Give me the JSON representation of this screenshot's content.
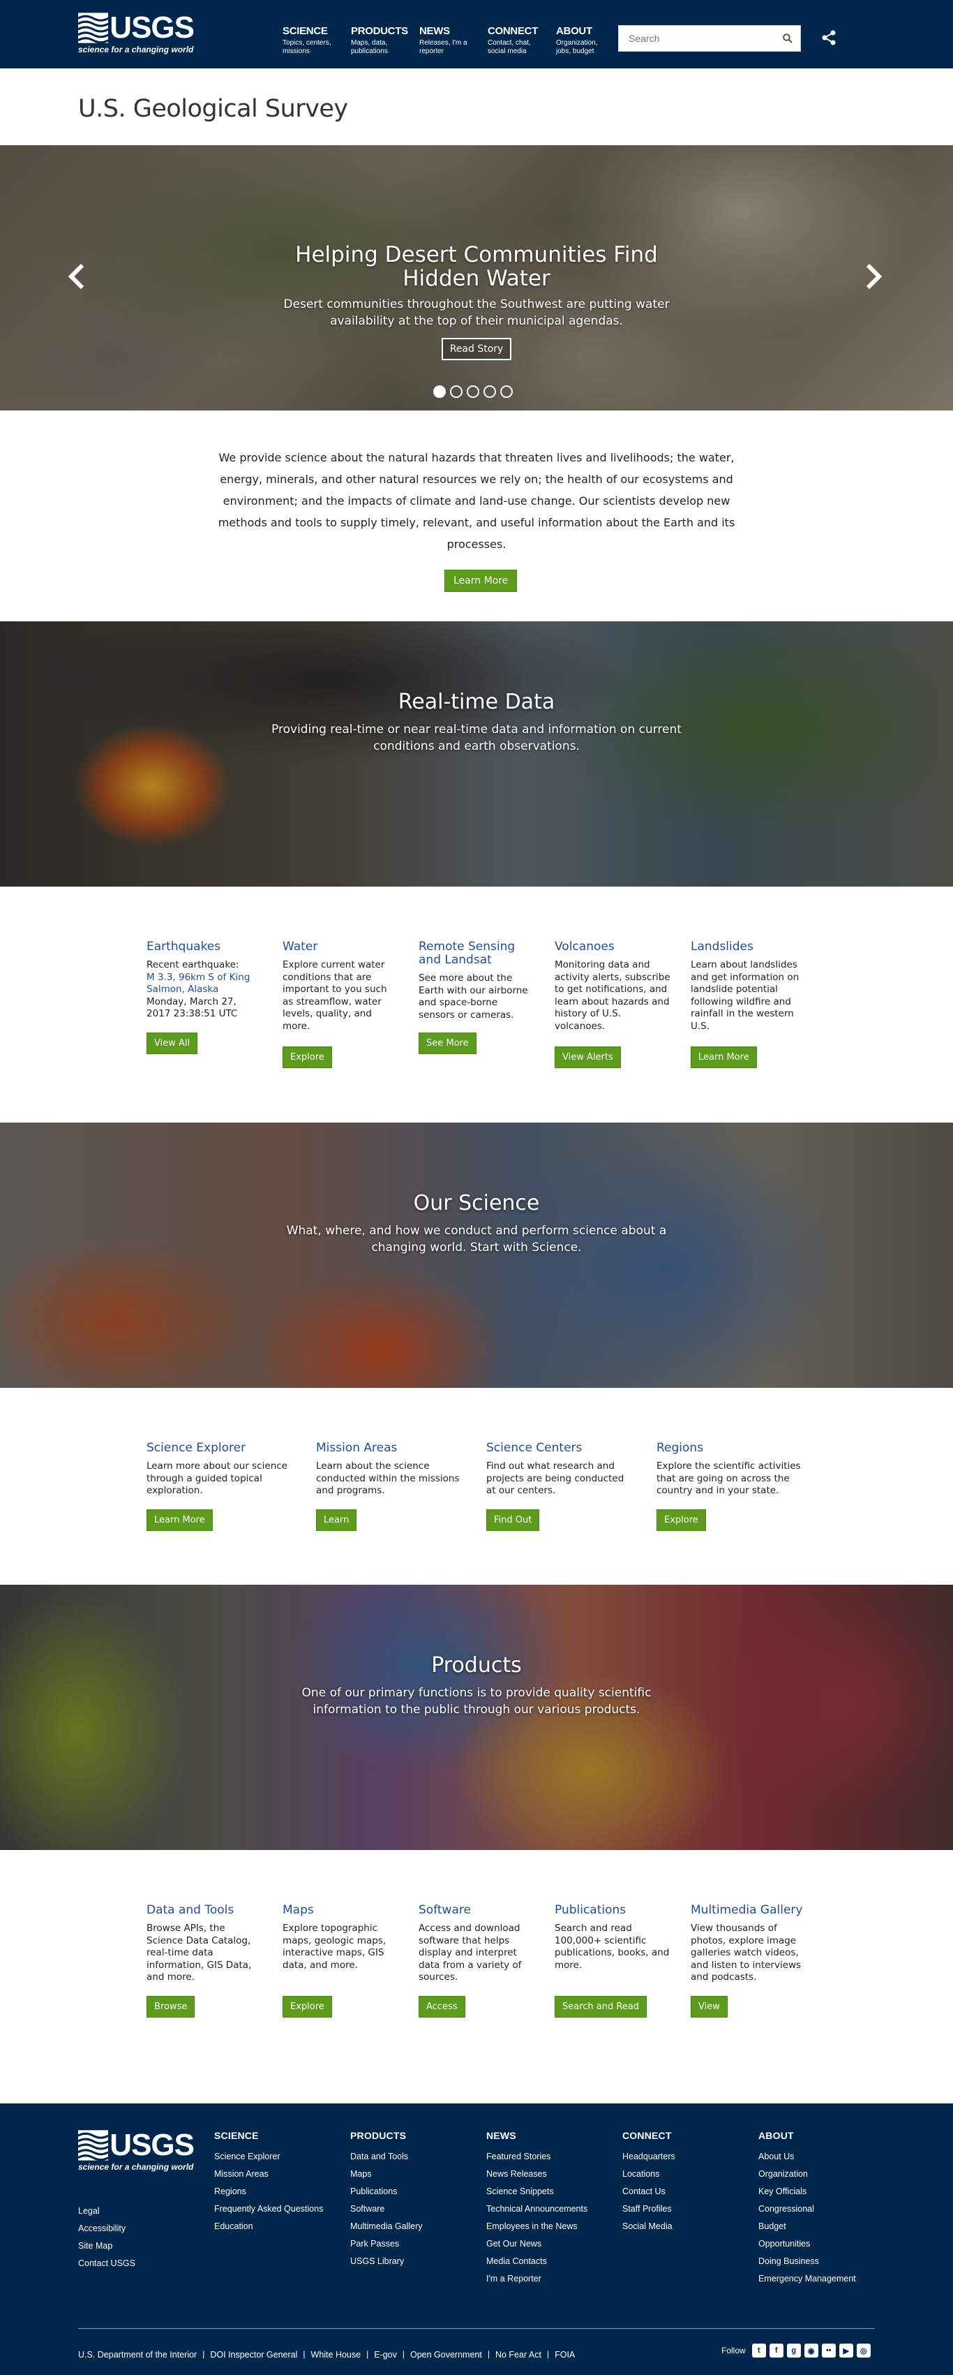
{
  "brand": {
    "name": "USGS",
    "tagline": "science for a changing world"
  },
  "nav": [
    {
      "title": "SCIENCE",
      "sub": "Topics, centers, missions"
    },
    {
      "title": "PRODUCTS",
      "sub": "Maps, data, publications"
    },
    {
      "title": "NEWS",
      "sub": "Releases, I'm a reporter"
    },
    {
      "title": "CONNECT",
      "sub": "Contact, chat, social media"
    },
    {
      "title": "ABOUT",
      "sub": "Organization, jobs, budget"
    }
  ],
  "search": {
    "placeholder": "Search"
  },
  "page_title": "U.S. Geological Survey",
  "hero": {
    "title": "Helping Desert Communities Find Hidden Water",
    "desc": "Desert communities throughout the Southwest are putting water availability at the top of their municipal agendas.",
    "button": "Read Story"
  },
  "intro": {
    "text": "We provide science about the natural hazards that threaten lives and livelihoods; the water, energy, minerals, and other natural resources we rely on; the health of our ecosystems and environment; and the impacts of climate and land-use change. Our scientists develop new methods and tools to supply timely, relevant, and useful information about the Earth and its processes.",
    "button": "Learn More"
  },
  "realtime": {
    "title": "Real-time Data",
    "desc": "Providing real-time or near real-time data and information on current conditions and earth observations.",
    "cards": [
      {
        "title": "Earthquakes",
        "desc_pre": "Recent earthquake:",
        "link": "M 3.3, 96km S of King Salmon, Alaska",
        "desc_post": " Monday, March 27, 2017 23:38:51 UTC",
        "button": "View All"
      },
      {
        "title": "Water",
        "desc": "Explore current water conditions that are important to you such as streamflow, water levels, quality, and more.",
        "button": "Explore"
      },
      {
        "title": "Remote Sensing and Landsat",
        "desc": "See more about the Earth with our airborne and space-borne sensors or cameras.",
        "button": "See More"
      },
      {
        "title": "Volcanoes",
        "desc": "Monitoring data and activity alerts, subscribe to get notifications, and learn about hazards and history of U.S. volcanoes.",
        "button": "View Alerts"
      },
      {
        "title": "Landslides",
        "desc": "Learn about landslides and get information on landslide potential following wildfire and rainfall in the western U.S.",
        "button": "Learn More"
      }
    ]
  },
  "science": {
    "title": "Our Science",
    "desc": "What, where, and how we conduct and perform science about a changing world. Start with Science.",
    "cards": [
      {
        "title": "Science Explorer",
        "desc": "Learn more about our science through a guided topical exploration.",
        "button": "Learn More"
      },
      {
        "title": "Mission Areas",
        "desc": "Learn about the science conducted within the missions and programs.",
        "button": "Learn"
      },
      {
        "title": "Science Centers",
        "desc": "Find out what research and projects are being conducted at our centers.",
        "button": "Find Out"
      },
      {
        "title": "Regions",
        "desc": "Explore the scientific activities that are going on across the country and in your state.",
        "button": "Explore"
      }
    ]
  },
  "products": {
    "title": "Products",
    "desc": "One of our primary functions is to provide quality scientific information to the public through our various products.",
    "cards": [
      {
        "title": "Data and Tools",
        "desc": "Browse APIs, the Science Data Catalog, real-time data information, GIS Data, and more.",
        "button": "Browse"
      },
      {
        "title": "Maps",
        "desc": "Explore topographic maps, geologic maps, interactive maps, GIS data, and more.",
        "button": "Explore"
      },
      {
        "title": "Software",
        "desc": "Access and download software that helps display and interpret data from a variety of sources.",
        "button": "Access"
      },
      {
        "title": "Publications",
        "desc": "Search and read 100,000+ scientific publications, books, and more.",
        "button": "Search and Read"
      },
      {
        "title": "Multimedia Gallery",
        "desc": "View thousands of photos, explore image galleries watch videos, and listen to interviews and podcasts.",
        "button": "View"
      }
    ]
  },
  "footer": {
    "left_links": [
      "Legal",
      "Accessibility",
      "Site Map",
      "Contact USGS"
    ],
    "columns": [
      {
        "title": "SCIENCE",
        "links": [
          "Science Explorer",
          "Mission Areas",
          "Regions",
          "Frequently Asked Questions",
          "Education"
        ]
      },
      {
        "title": "PRODUCTS",
        "links": [
          "Data and Tools",
          "Maps",
          "Publications",
          "Software",
          "Multimedia Gallery",
          "Park Passes",
          "USGS Library"
        ]
      },
      {
        "title": "NEWS",
        "links": [
          "Featured Stories",
          "News Releases",
          "Science Snippets",
          "Technical Announcements",
          "Employees in the News",
          "Get Our News",
          "Media Contacts",
          "I'm a Reporter"
        ]
      },
      {
        "title": "CONNECT",
        "links": [
          "Headquarters",
          "Locations",
          "Contact Us",
          "Staff Profiles",
          "Social Media"
        ]
      },
      {
        "title": "ABOUT",
        "links": [
          "About Us",
          "Organization",
          "Key Officials",
          "Congressional",
          "Budget",
          "Opportunities",
          "Doing Business",
          "Emergency Management"
        ]
      }
    ],
    "bottom_links": [
      "U.S. Department of the Interior",
      "DOI Inspector General",
      "White House",
      "E-gov",
      "Open Government",
      "No Fear Act",
      "FOIA"
    ],
    "follow": "Follow"
  },
  "colors": {
    "navy": "#00264c",
    "green": "#5d9b1c",
    "link": "#1e4f96"
  }
}
